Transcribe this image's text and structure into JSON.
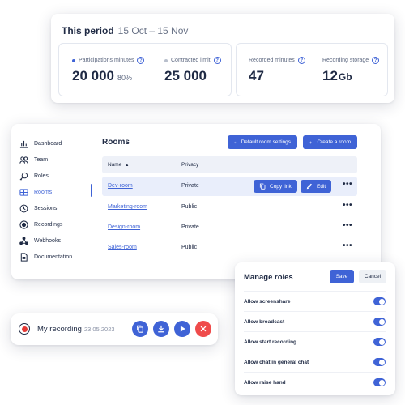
{
  "period": {
    "title": "This period",
    "range": "15 Oct – 15 Nov",
    "stats": [
      {
        "label": "Participations minutes",
        "value": "20 000",
        "extra": "80%",
        "dot_color": "#3f63d6"
      },
      {
        "label": "Contracted limit",
        "value": "25 000",
        "dot_color": "#b8bfcc"
      },
      {
        "label": "Recorded minutes",
        "value": "47"
      },
      {
        "label": "Recording storage",
        "value": "12",
        "unit": "Gb"
      }
    ],
    "info_glyph": "?"
  },
  "sidebar": {
    "items": [
      {
        "label": "Dashboard",
        "icon": "dashboard-icon"
      },
      {
        "label": "Team",
        "icon": "team-icon"
      },
      {
        "label": "Roles",
        "icon": "roles-icon"
      },
      {
        "label": "Rooms",
        "icon": "rooms-icon",
        "active": true
      },
      {
        "label": "Sessions",
        "icon": "sessions-icon"
      },
      {
        "label": "Recordings",
        "icon": "recordings-icon"
      },
      {
        "label": "Webhooks",
        "icon": "webhooks-icon"
      },
      {
        "label": "Documentation",
        "icon": "documentation-icon"
      }
    ]
  },
  "rooms": {
    "title": "Rooms",
    "default_settings_label": "Default room settings",
    "create_label": "Create a room",
    "columns": {
      "name": "Name",
      "privacy": "Privacy"
    },
    "sort_glyph": "▲",
    "more_glyph": "•••",
    "copy_link_label": "Copy link",
    "edit_label": "Edit",
    "rows": [
      {
        "name": "Dev-room",
        "privacy": "Private"
      },
      {
        "name": "Marketing-room",
        "privacy": "Public"
      },
      {
        "name": "Design-room",
        "privacy": "Private"
      },
      {
        "name": "Sales-room",
        "privacy": "Public"
      }
    ]
  },
  "roles": {
    "title": "Manage roles",
    "save_label": "Save",
    "cancel_label": "Cancel",
    "permissions": [
      {
        "label": "Allow screenshare",
        "enabled": true
      },
      {
        "label": "Allow broadcast",
        "enabled": true
      },
      {
        "label": "Allow start recording",
        "enabled": true
      },
      {
        "label": "Allow chat in general chat",
        "enabled": true
      },
      {
        "label": "Allow raise hand",
        "enabled": true
      }
    ]
  },
  "recording": {
    "name": "My recording",
    "date": "23.05.2023",
    "actions": [
      "copy-icon",
      "download-icon",
      "play-icon",
      "close-icon"
    ]
  },
  "colors": {
    "accent": "#3f63d6",
    "danger": "#ef4b4b",
    "record": "#e53935"
  }
}
